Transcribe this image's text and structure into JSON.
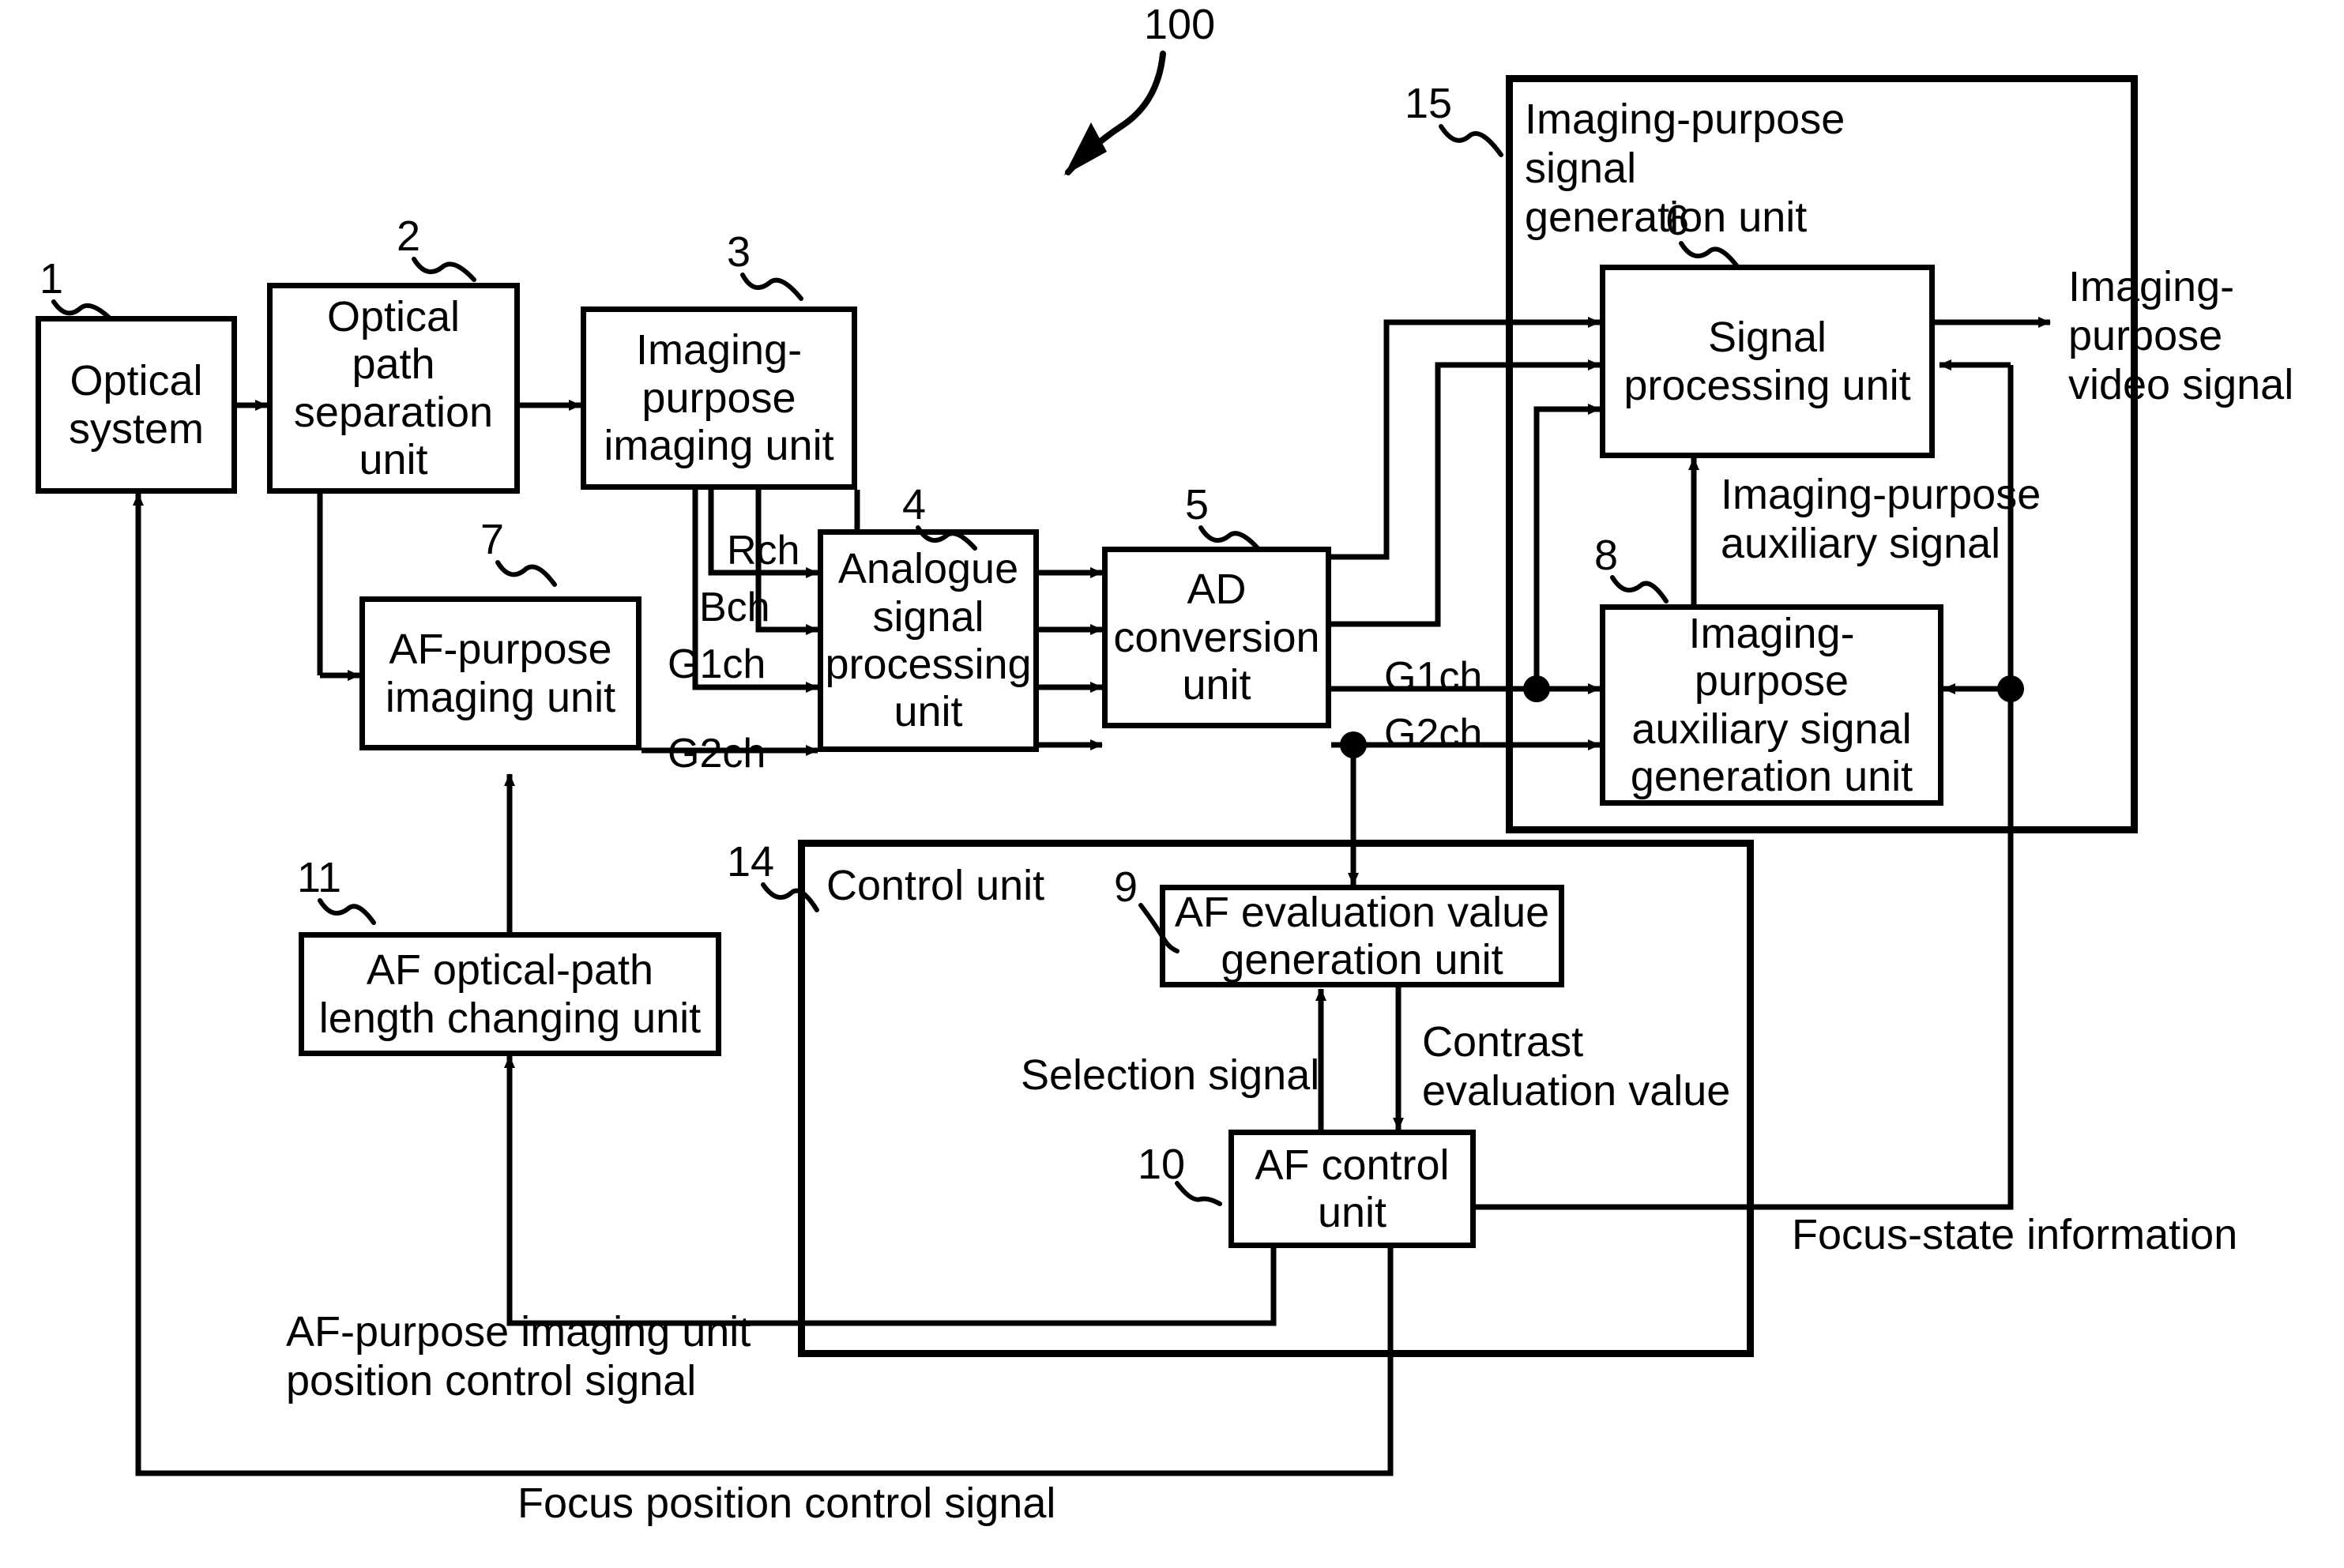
{
  "figure": {
    "system_ref": "100"
  },
  "blocks": [
    {
      "id": "optical_system",
      "ref": "1",
      "text": "Optical\nsystem"
    },
    {
      "id": "optical_path_sep",
      "ref": "2",
      "text": "Optical\npath\nseparation\nunit"
    },
    {
      "id": "imaging_unit",
      "ref": "3",
      "text": "Imaging-\npurpose\nimaging unit"
    },
    {
      "id": "af_imaging_unit",
      "ref": "7",
      "text": "AF-purpose\nimaging unit"
    },
    {
      "id": "analogue_sp",
      "ref": "4",
      "text": "Analogue\nsignal\nprocessing\nunit"
    },
    {
      "id": "ad_conversion",
      "ref": "5",
      "text": "AD\nconversion\nunit"
    },
    {
      "id": "signal_processing",
      "ref": "6",
      "text": "Signal\nprocessing unit"
    },
    {
      "id": "aux_signal_gen",
      "ref": "8",
      "text": "Imaging-\npurpose\nauxiliary signal\ngeneration unit"
    },
    {
      "id": "af_eval_gen",
      "ref": "9",
      "text": "AF evaluation value\ngeneration unit"
    },
    {
      "id": "af_control",
      "ref": "10",
      "text": "AF control\nunit"
    },
    {
      "id": "af_path_len",
      "ref": "11",
      "text": "AF optical-path\nlength changing unit"
    }
  ],
  "groups": [
    {
      "id": "imaging_signal_gen_unit",
      "ref": "15",
      "title": "Imaging-purpose signal\ngeneration unit"
    },
    {
      "id": "control_unit",
      "ref": "14",
      "title": "Control unit"
    }
  ],
  "signal_labels": {
    "rch": "Rch",
    "bch": "Bch",
    "g1ch_left": "G1ch",
    "g2ch_left": "G2ch",
    "g1ch_right": "G1ch",
    "g2ch_right": "G2ch",
    "imaging_video_signal": "Imaging-\npurpose\nvideo signal",
    "imaging_aux_signal": "Imaging-purpose\nauxiliary signal",
    "selection_signal": "Selection signal",
    "contrast_eval_value": "Contrast\nevaluation value",
    "focus_state_information": "Focus-state information",
    "af_pos_control_signal": "AF-purpose imaging unit\nposition control signal",
    "focus_position_control_signal": "Focus position control signal"
  },
  "colors": {
    "ink": "#000000",
    "paper": "#ffffff"
  }
}
